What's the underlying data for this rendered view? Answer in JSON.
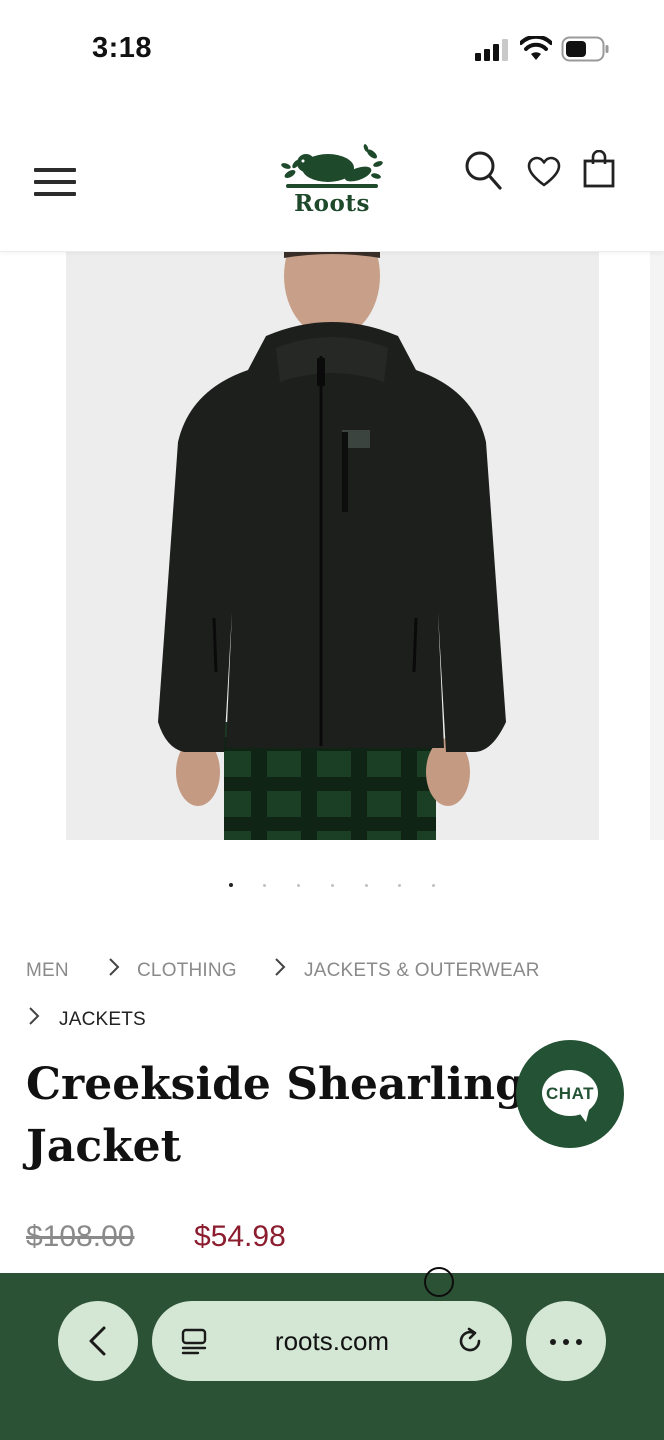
{
  "status_bar": {
    "time": "3:18",
    "icons": [
      "cellular-signal-icon",
      "wifi-icon",
      "battery-icon"
    ]
  },
  "header": {
    "brand": "Roots",
    "icons": [
      "hamburger-menu-icon",
      "search-icon",
      "heart-icon",
      "shopping-bag-icon"
    ],
    "brand_color": "#1e4a2b"
  },
  "product": {
    "image_dots_total": 7,
    "image_dots_active": 1,
    "breadcrumb": [
      "MEN",
      "CLOTHING",
      "JACKETS & OUTERWEAR",
      "JACKETS"
    ],
    "title_line1": "Creekside Shearling Fl",
    "title_line2": "Jacket",
    "price_original": "$108.00",
    "price_sale": "$54.98",
    "sale_color": "#8b1d2e"
  },
  "chat": {
    "label": "CHAT",
    "color": "#245234"
  },
  "browser": {
    "url": "roots.com",
    "toolbar_color": "#2c5236",
    "button_color": "#d4e6d4",
    "icons": [
      "back-chevron-icon",
      "reader-mode-icon",
      "reload-icon",
      "more-options-icon"
    ]
  }
}
